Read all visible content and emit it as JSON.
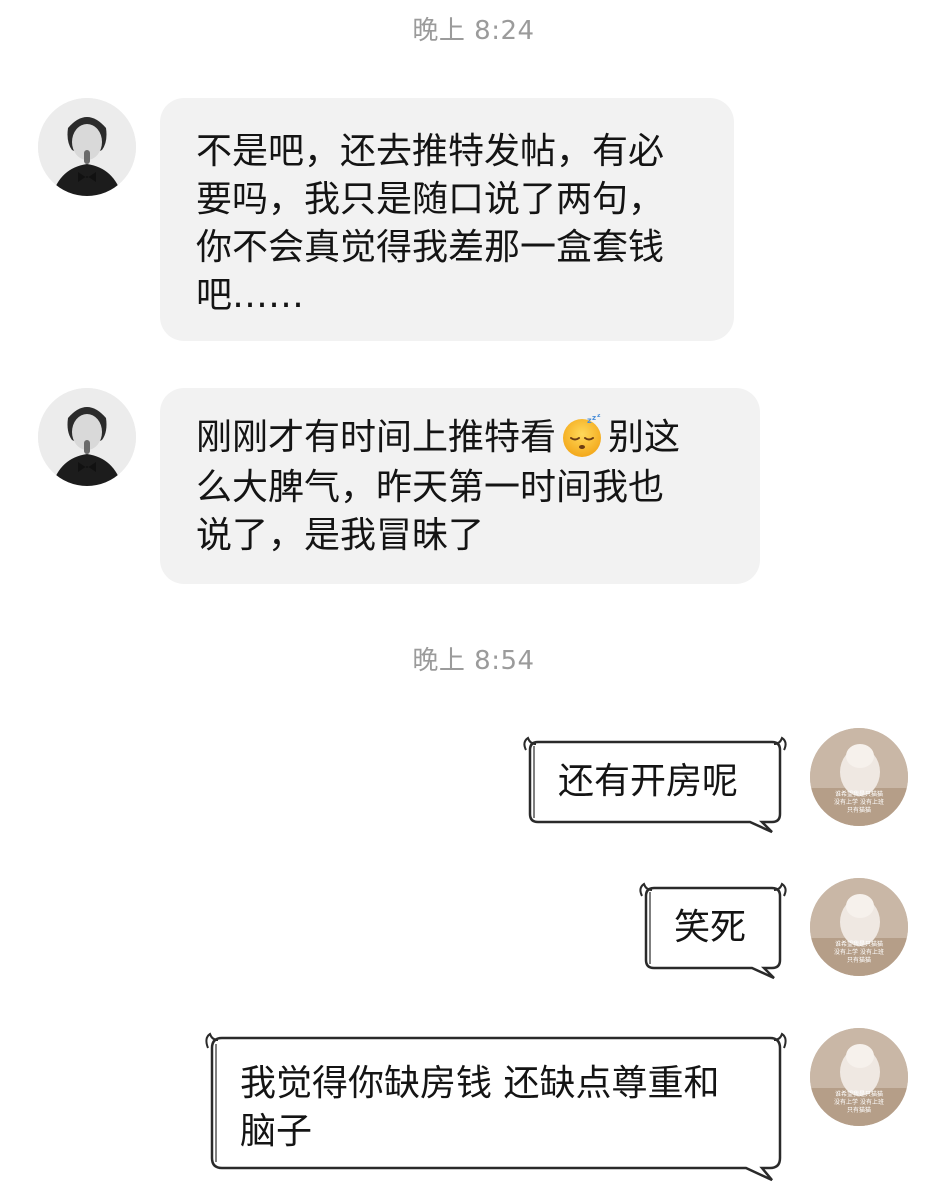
{
  "timestamps": {
    "first": "晚上 8:24",
    "second": "晚上 8:54"
  },
  "messages": {
    "in1": {
      "lines": [
        "不是吧，还去推特发帖，有必",
        "要吗，我只是随口说了两句，",
        "你不会真觉得我差那一盒套钱",
        "吧……"
      ]
    },
    "in2": {
      "line1_before_emoji": "刚刚才有时间上推特看",
      "emoji_name": "sleeping-face-emoji",
      "line1_after_emoji": "别这",
      "lines": [
        "么大脾气，昨天第一时间我也",
        "说了，是我冒昧了"
      ]
    },
    "out1": {
      "text": "还有开房呢"
    },
    "out2": {
      "text": "笑死"
    },
    "out3": {
      "lines": [
        "我觉得你缺房钱 还缺点尊重和",
        "脑子"
      ]
    }
  },
  "avatar_caption": {
    "line1": "谁希望我是只猫猫",
    "line2": "没有上学 没有上班",
    "line3": "只有猫猫"
  },
  "colors": {
    "timestamp": "#9b9b9b",
    "incoming_bubble": "#f2f2f2",
    "outgoing_bubble": "#ffffff",
    "outgoing_border": "#2a2a2a"
  }
}
